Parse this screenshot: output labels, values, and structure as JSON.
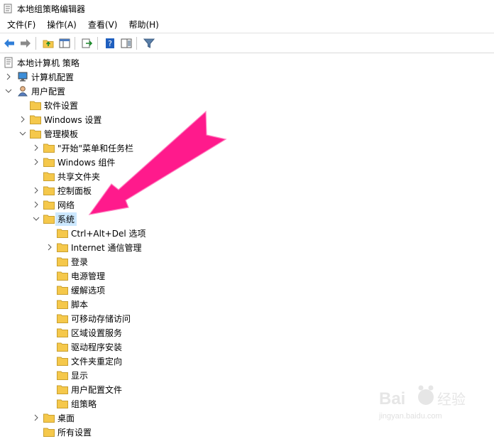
{
  "window": {
    "title": "本地组策略编辑器"
  },
  "menu": [
    "文件(F)",
    "操作(A)",
    "查看(V)",
    "帮助(H)"
  ],
  "tree": {
    "root": "本地计算机 策略",
    "computer_config": "计算机配置",
    "user_config": "用户配置",
    "software_settings": "软件设置",
    "windows_settings": "Windows 设置",
    "admin_templates": "管理模板",
    "start_menu": "\"开始\"菜单和任务栏",
    "windows_components": "Windows 组件",
    "shared_folders": "共享文件夹",
    "control_panel": "控制面板",
    "network": "网络",
    "system": "系统",
    "system_children": [
      "Ctrl+Alt+Del 选项",
      "Internet 通信管理",
      "登录",
      "电源管理",
      "缓解选项",
      "脚本",
      "可移动存储访问",
      "区域设置服务",
      "驱动程序安装",
      "文件夹重定向",
      "显示",
      "用户配置文件",
      "组策略"
    ],
    "desktop": "桌面",
    "all_settings": "所有设置"
  },
  "watermark": {
    "brand": "Bai",
    "brand2": "经验",
    "url": "jingyan.baidu.com"
  },
  "colors": {
    "arrow": "#ff1a8c",
    "selection": "#cce8ff",
    "folder": "#f5c84b"
  }
}
